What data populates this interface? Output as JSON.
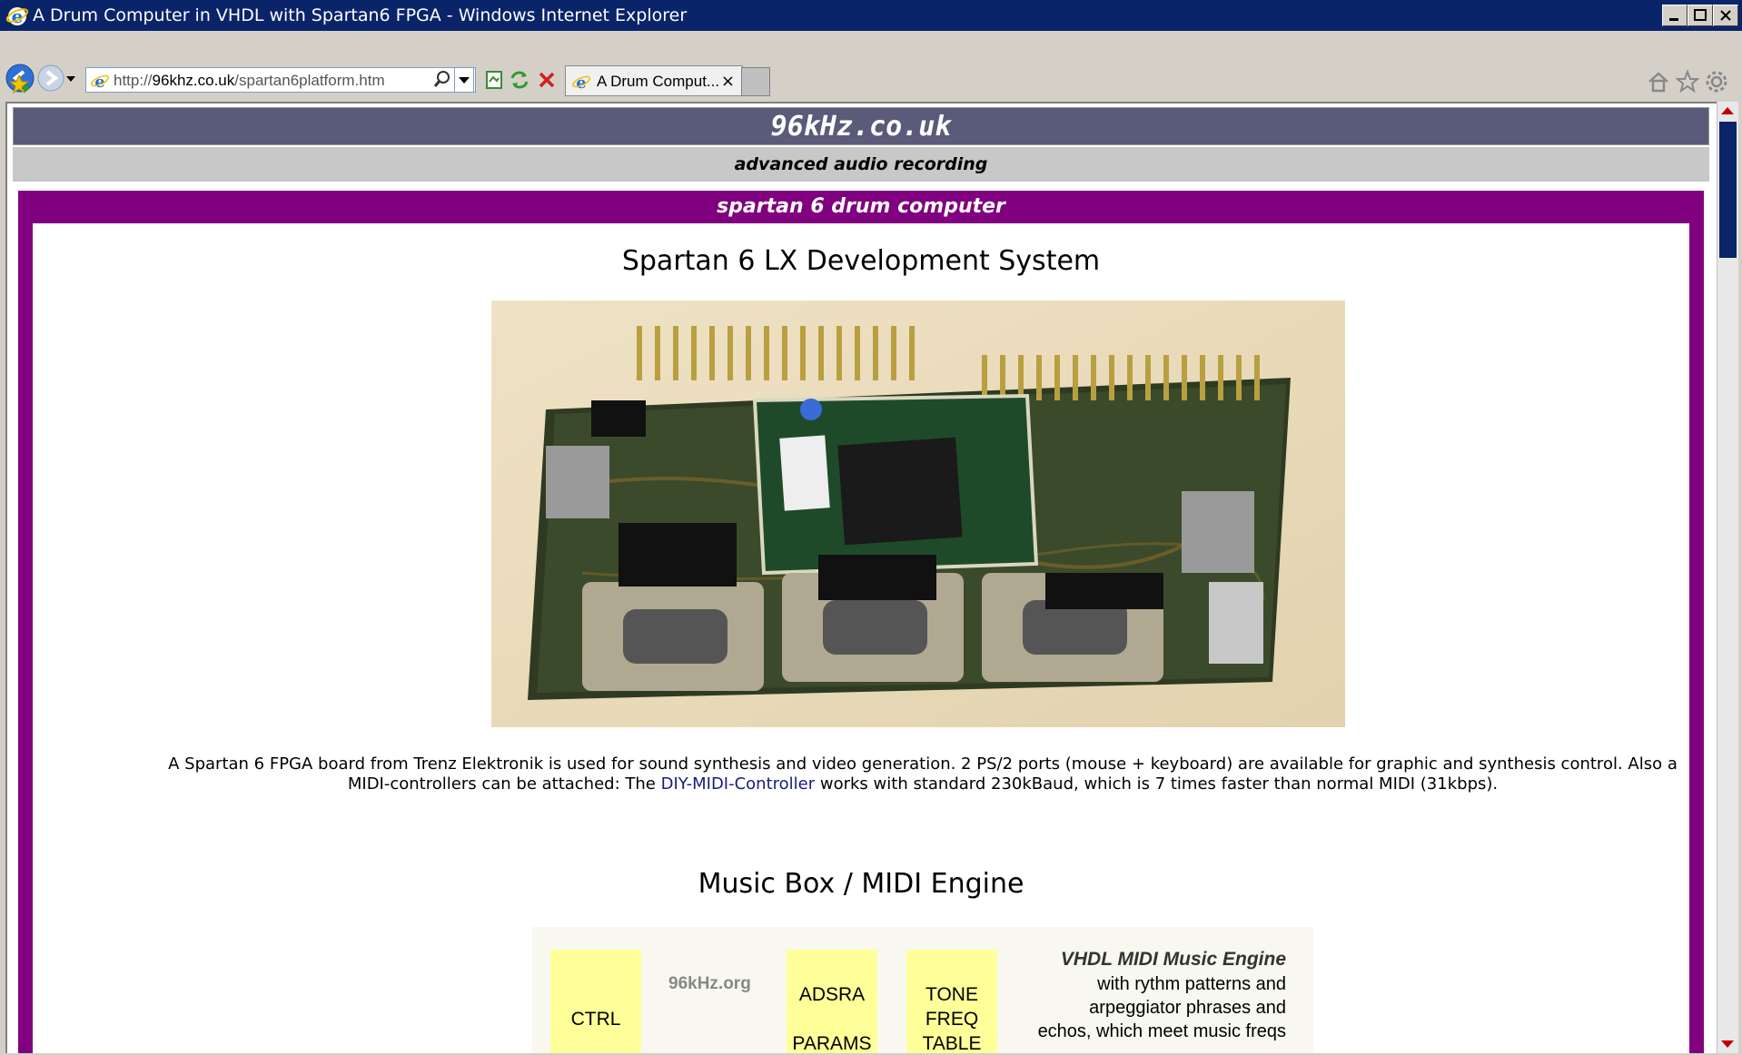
{
  "window": {
    "title": "A Drum Computer in VHDL with Spartan6 FPGA - Windows Internet Explorer"
  },
  "toolbar": {
    "url_prefix": "http://",
    "url_domain": "96khz.co.uk",
    "url_path": "/spartan6platform.htm",
    "tab_label": "A Drum Comput...",
    "tab_close": "×"
  },
  "page": {
    "site_name": "96kHz.co.uk",
    "tagline": "advanced audio recording",
    "section_title": "spartan 6 drum computer",
    "heading1": "Spartan 6 LX Development System",
    "paragraph_before_link": "A Spartan 6 FPGA board from Trenz Elektronik is used for sound synthesis and video generation. 2 PS/2 ports (mouse + keyboard) are available for graphic and synthesis control. Also a MIDI-controllers can be attached: The ",
    "paragraph_link": "DIY-MIDI-Controller",
    "paragraph_after_link": " works with standard 230kBaud, which is 7 times faster than normal MIDI (31kbps).",
    "heading2": "Music Box / MIDI Engine",
    "diagram": {
      "box_ctrl": "CTRL",
      "org_label": "96kHz.org",
      "box_adsra_1": "ADSRA",
      "box_adsra_2": "PARAMS",
      "box_tone_1": "TONE",
      "box_tone_2": "FREQ",
      "box_tone_3": "TABLE",
      "engine_title": "VHDL MIDI Music Engine",
      "engine_line1": "with rythm patterns and",
      "engine_line2": "arpeggiator phrases and",
      "engine_line3": "echos, which meet music freqs"
    }
  }
}
